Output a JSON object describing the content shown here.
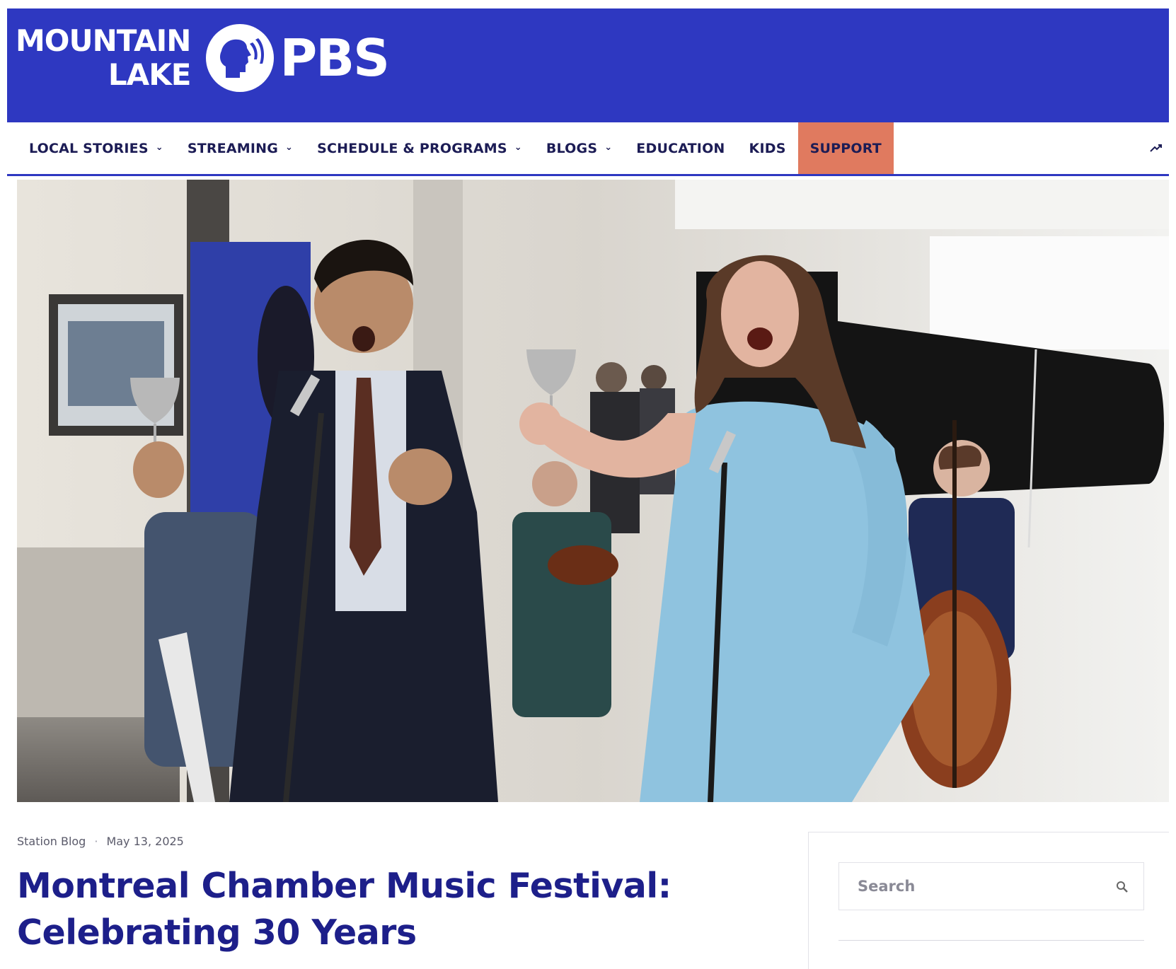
{
  "brand": {
    "logo_line1": "MOUNTAIN",
    "logo_line2": "LAKE",
    "logo_wordmark": "PBS",
    "color": "#2e38c1"
  },
  "nav": {
    "items": [
      {
        "label": "LOCAL STORIES",
        "dropdown": true
      },
      {
        "label": "STREAMING",
        "dropdown": true
      },
      {
        "label": "SCHEDULE & PROGRAMS",
        "dropdown": true
      },
      {
        "label": "BLOGS",
        "dropdown": true
      },
      {
        "label": "EDUCATION",
        "dropdown": false
      },
      {
        "label": "KIDS",
        "dropdown": false
      },
      {
        "label": "SUPPORT",
        "dropdown": false,
        "highlight_color": "#e07a5f"
      }
    ],
    "trending_icon": "trending-icon"
  },
  "hero": {
    "description": "Photo"
  },
  "article": {
    "category": "Station Blog",
    "separator": "·",
    "date": "May 13, 2025",
    "title_line1": "Montreal Chamber Music Festival:",
    "title_line2": "Celebrating 30 Years"
  },
  "sidebar": {
    "search_placeholder": "Search",
    "search_icon": "search-icon"
  }
}
